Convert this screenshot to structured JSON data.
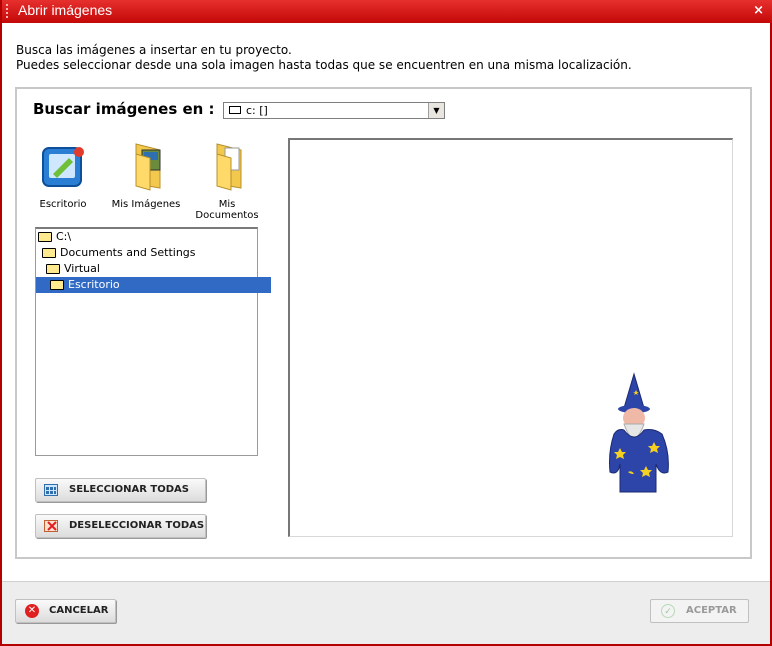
{
  "window": {
    "title": "Abrir imágenes",
    "close_glyph": "×"
  },
  "intro": {
    "line1": "Busca las imágenes a insertar en tu proyecto.",
    "line2": "Puedes seleccionar desde una sola imagen hasta todas que se encuentren en una misma localización."
  },
  "search": {
    "label": "Buscar imágenes en :",
    "drive_value": "c: []"
  },
  "shortcuts": [
    {
      "label": "Escritorio",
      "icon": "desktop-icon"
    },
    {
      "label": "Mis Imágenes",
      "icon": "my-pictures-folder-icon"
    },
    {
      "label": "Mis Documentos",
      "icon": "my-documents-folder-icon"
    }
  ],
  "tree": [
    {
      "label": "C:\\",
      "selected": false
    },
    {
      "label": "Documents and Settings",
      "selected": false
    },
    {
      "label": "Virtual",
      "selected": false
    },
    {
      "label": "Escritorio",
      "selected": true
    }
  ],
  "buttons": {
    "select_all": "SELECCIONAR TODAS",
    "deselect_all": "DESELECCIONAR TODAS",
    "cancel": "CANCELAR",
    "accept": "ACEPTAR"
  },
  "colors": {
    "title_bar": "#d41515",
    "selection": "#316ac5",
    "accept_disabled": "#9a9a9a"
  }
}
